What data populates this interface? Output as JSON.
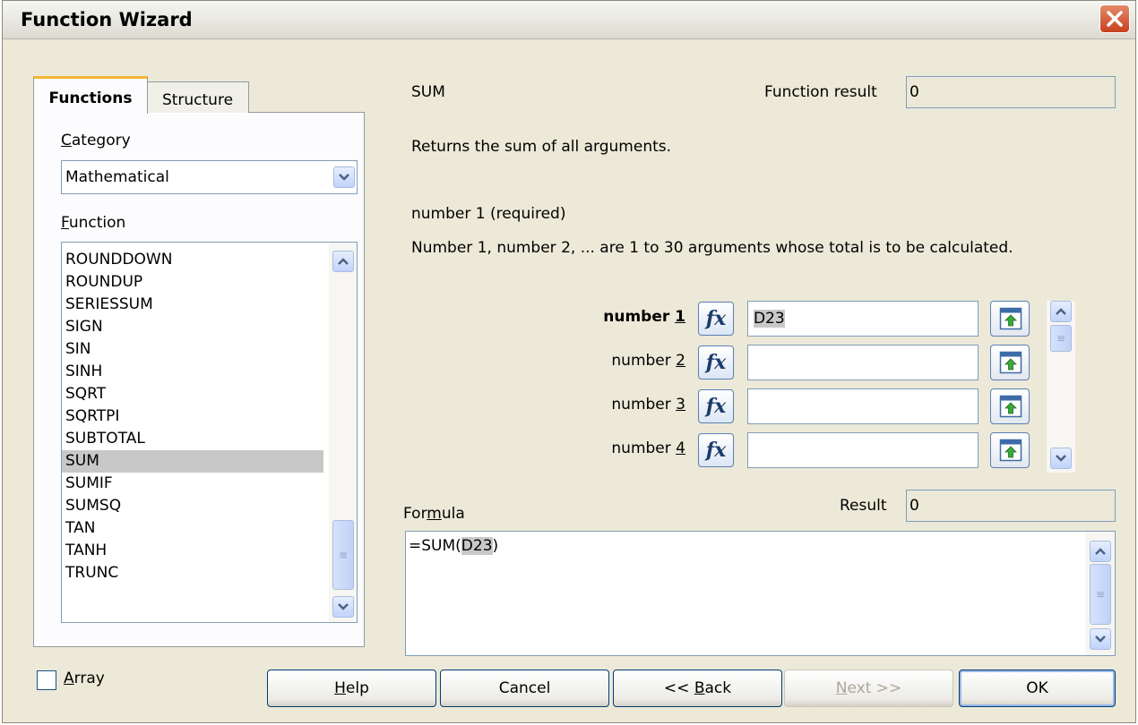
{
  "window": {
    "title": "Function Wizard"
  },
  "tabs": [
    {
      "label": "Functions",
      "active": true
    },
    {
      "label": "Structure",
      "active": false
    }
  ],
  "category": {
    "label": "Category",
    "value": "Mathematical"
  },
  "function_list": {
    "label": "Function",
    "items": [
      "ROUNDDOWN",
      "ROUNDUP",
      "SERIESSUM",
      "SIGN",
      "SIN",
      "SINH",
      "SQRT",
      "SQRTPI",
      "SUBTOTAL",
      "SUM",
      "SUMIF",
      "SUMSQ",
      "TAN",
      "TANH",
      "TRUNC"
    ],
    "selected": "SUM"
  },
  "function_info": {
    "name": "SUM",
    "result_label": "Function result",
    "result_value": "0",
    "description": "Returns the sum of all arguments.",
    "arg_title": "number 1 (required)",
    "arg_description": "Number 1, number 2, ... are 1 to 30 arguments whose total is to be calculated."
  },
  "arguments": [
    {
      "prefix": "number ",
      "num": "1",
      "value": "D23"
    },
    {
      "prefix": "number ",
      "num": "2",
      "value": ""
    },
    {
      "prefix": "number ",
      "num": "3",
      "value": ""
    },
    {
      "prefix": "number ",
      "num": "4",
      "value": ""
    }
  ],
  "formula": {
    "label_pre": "For",
    "label_key": "m",
    "label_post": "ula",
    "result_label": "Result",
    "result_value": "0",
    "text_pre": "=SUM(",
    "text_ref": "D23",
    "text_post": ")"
  },
  "array_checkbox": {
    "label": "Array",
    "checked": false
  },
  "buttons": {
    "help": "Help",
    "cancel": "Cancel",
    "back": "<< Back",
    "next": "Next >>",
    "ok": "OK"
  },
  "colors": {
    "selection": "#c8c8c8",
    "button_border": "#003c74",
    "panel_bg": "#ece9d8"
  }
}
